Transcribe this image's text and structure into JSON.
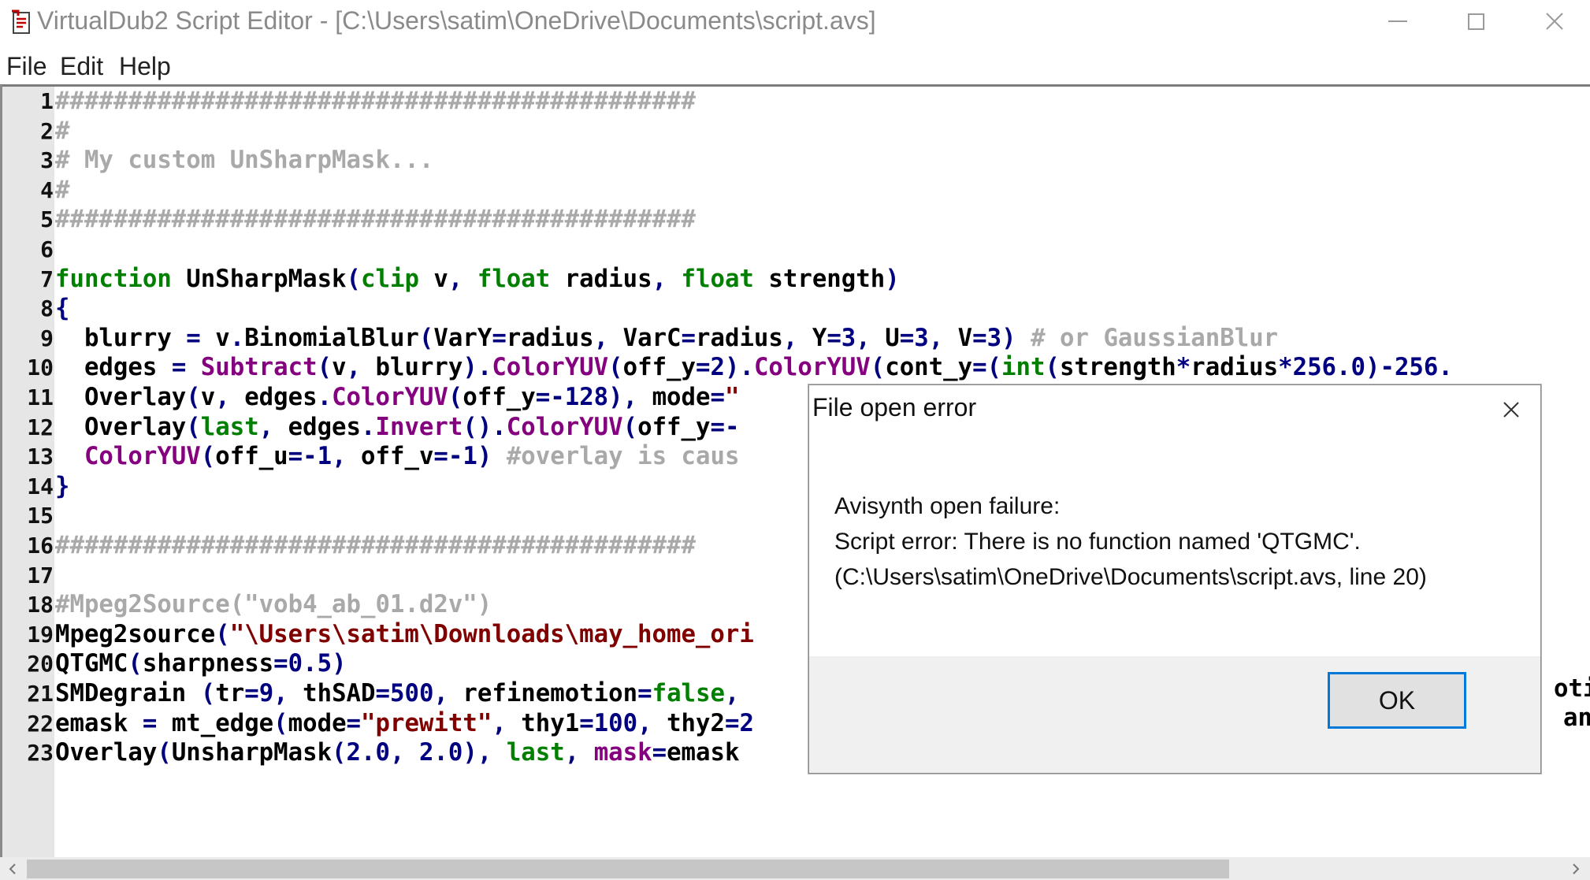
{
  "window": {
    "title": "VirtualDub2 Script Editor - [C:\\Users\\satim\\OneDrive\\Documents\\script.avs]"
  },
  "menu": {
    "file": "File",
    "edit": "Edit",
    "help": "Help"
  },
  "lines": [
    {
      "n": "1",
      "tokens": [
        [
          "cm",
          "############################################"
        ]
      ]
    },
    {
      "n": "2",
      "tokens": [
        [
          "cm",
          "#"
        ]
      ]
    },
    {
      "n": "3",
      "tokens": [
        [
          "cm",
          "# My custom UnSharpMask..."
        ]
      ]
    },
    {
      "n": "4",
      "tokens": [
        [
          "cm",
          "#"
        ]
      ]
    },
    {
      "n": "5",
      "tokens": [
        [
          "cm",
          "############################################"
        ]
      ]
    },
    {
      "n": "6",
      "tokens": []
    },
    {
      "n": "7",
      "tokens": [
        [
          "kw",
          "function"
        ],
        [
          "tx",
          " UnSharpMask"
        ],
        [
          "op",
          "("
        ],
        [
          "kw",
          "clip"
        ],
        [
          "tx",
          " v"
        ],
        [
          "op",
          ","
        ],
        [
          "tx",
          " "
        ],
        [
          "kw",
          "float"
        ],
        [
          "tx",
          " radius"
        ],
        [
          "op",
          ","
        ],
        [
          "tx",
          " "
        ],
        [
          "kw",
          "float"
        ],
        [
          "tx",
          " strength"
        ],
        [
          "op",
          ")"
        ]
      ]
    },
    {
      "n": "8",
      "tokens": [
        [
          "op",
          "{"
        ]
      ]
    },
    {
      "n": "9",
      "tokens": [
        [
          "tx",
          "  blurry "
        ],
        [
          "op",
          "="
        ],
        [
          "tx",
          " v"
        ],
        [
          "op",
          "."
        ],
        [
          "tx",
          "BinomialBlur"
        ],
        [
          "op",
          "("
        ],
        [
          "tx",
          "VarY"
        ],
        [
          "op",
          "="
        ],
        [
          "tx",
          "radius"
        ],
        [
          "op",
          ","
        ],
        [
          "tx",
          " VarC"
        ],
        [
          "op",
          "="
        ],
        [
          "tx",
          "radius"
        ],
        [
          "op",
          ","
        ],
        [
          "tx",
          " Y"
        ],
        [
          "op",
          "="
        ],
        [
          "nb",
          "3"
        ],
        [
          "op",
          ","
        ],
        [
          "tx",
          " U"
        ],
        [
          "op",
          "="
        ],
        [
          "nb",
          "3"
        ],
        [
          "op",
          ","
        ],
        [
          "tx",
          " V"
        ],
        [
          "op",
          "="
        ],
        [
          "nb",
          "3"
        ],
        [
          "op",
          ")"
        ],
        [
          "tx",
          " "
        ],
        [
          "cm",
          "# or GaussianBlur"
        ]
      ]
    },
    {
      "n": "10",
      "tokens": [
        [
          "tx",
          "  edges "
        ],
        [
          "op",
          "="
        ],
        [
          "tx",
          " "
        ],
        [
          "fn",
          "Subtract"
        ],
        [
          "op",
          "("
        ],
        [
          "tx",
          "v"
        ],
        [
          "op",
          ","
        ],
        [
          "tx",
          " blurry"
        ],
        [
          "op",
          ")."
        ],
        [
          "fn",
          "ColorYUV"
        ],
        [
          "op",
          "("
        ],
        [
          "tx",
          "off_y"
        ],
        [
          "op",
          "="
        ],
        [
          "nb",
          "2"
        ],
        [
          "op",
          ")."
        ],
        [
          "fn",
          "ColorYUV"
        ],
        [
          "op",
          "("
        ],
        [
          "tx",
          "cont_y"
        ],
        [
          "op",
          "=("
        ],
        [
          "kw",
          "int"
        ],
        [
          "op",
          "("
        ],
        [
          "tx",
          "strength"
        ],
        [
          "op",
          "*"
        ],
        [
          "tx",
          "radius"
        ],
        [
          "op",
          "*"
        ],
        [
          "nb",
          "256.0"
        ],
        [
          "op",
          ")-"
        ],
        [
          "nb",
          "256."
        ]
      ]
    },
    {
      "n": "11",
      "tokens": [
        [
          "tx",
          "  Overlay"
        ],
        [
          "op",
          "("
        ],
        [
          "tx",
          "v"
        ],
        [
          "op",
          ","
        ],
        [
          "tx",
          " edges"
        ],
        [
          "op",
          "."
        ],
        [
          "fn",
          "ColorYUV"
        ],
        [
          "op",
          "("
        ],
        [
          "tx",
          "off_y"
        ],
        [
          "op",
          "=-"
        ],
        [
          "nb",
          "128"
        ],
        [
          "op",
          "),"
        ],
        [
          "tx",
          " mode"
        ],
        [
          "op",
          "="
        ],
        [
          "st",
          "\""
        ]
      ]
    },
    {
      "n": "12",
      "tokens": [
        [
          "tx",
          "  Overlay"
        ],
        [
          "op",
          "("
        ],
        [
          "kw",
          "last"
        ],
        [
          "op",
          ","
        ],
        [
          "tx",
          " edges"
        ],
        [
          "op",
          "."
        ],
        [
          "fn",
          "Invert"
        ],
        [
          "op",
          "()."
        ],
        [
          "fn",
          "ColorYUV"
        ],
        [
          "op",
          "("
        ],
        [
          "tx",
          "off_y"
        ],
        [
          "op",
          "=-"
        ]
      ]
    },
    {
      "n": "13",
      "tokens": [
        [
          "tx",
          "  "
        ],
        [
          "fn",
          "ColorYUV"
        ],
        [
          "op",
          "("
        ],
        [
          "tx",
          "off_u"
        ],
        [
          "op",
          "=-"
        ],
        [
          "nb",
          "1"
        ],
        [
          "op",
          ","
        ],
        [
          "tx",
          " off_v"
        ],
        [
          "op",
          "=-"
        ],
        [
          "nb",
          "1"
        ],
        [
          "op",
          ")"
        ],
        [
          "tx",
          " "
        ],
        [
          "cm",
          "#overlay is caus"
        ]
      ]
    },
    {
      "n": "14",
      "tokens": [
        [
          "op",
          "}"
        ]
      ]
    },
    {
      "n": "15",
      "tokens": []
    },
    {
      "n": "16",
      "tokens": [
        [
          "cm",
          "############################################"
        ]
      ]
    },
    {
      "n": "17",
      "tokens": []
    },
    {
      "n": "18",
      "tokens": [
        [
          "cm",
          "#Mpeg2Source(\"vob4_ab_01.d2v\")"
        ]
      ]
    },
    {
      "n": "19",
      "tokens": [
        [
          "tx",
          "Mpeg2source"
        ],
        [
          "op",
          "("
        ],
        [
          "st",
          "\"\\Users\\satim\\Downloads\\may_home_ori"
        ]
      ]
    },
    {
      "n": "20",
      "tokens": [
        [
          "tx",
          "QTGMC"
        ],
        [
          "op",
          "("
        ],
        [
          "tx",
          "sharpness"
        ],
        [
          "op",
          "="
        ],
        [
          "nb",
          "0.5"
        ],
        [
          "op",
          ")"
        ]
      ]
    },
    {
      "n": "21",
      "tokens": [
        [
          "tx",
          "SMDegrain "
        ],
        [
          "op",
          "("
        ],
        [
          "tx",
          "tr"
        ],
        [
          "op",
          "="
        ],
        [
          "nb",
          "9"
        ],
        [
          "op",
          ","
        ],
        [
          "tx",
          " thSAD"
        ],
        [
          "op",
          "="
        ],
        [
          "nb",
          "500"
        ],
        [
          "op",
          ","
        ],
        [
          "tx",
          " refinemotion"
        ],
        [
          "op",
          "="
        ],
        [
          "kw",
          "false"
        ],
        [
          "op",
          ","
        ]
      ]
    },
    {
      "n": "22",
      "tokens": [
        [
          "tx",
          "emask "
        ],
        [
          "op",
          "="
        ],
        [
          "tx",
          " mt_edge"
        ],
        [
          "op",
          "("
        ],
        [
          "tx",
          "mode"
        ],
        [
          "op",
          "="
        ],
        [
          "st",
          "\"prewitt\""
        ],
        [
          "op",
          ","
        ],
        [
          "tx",
          " thy1"
        ],
        [
          "op",
          "="
        ],
        [
          "nb",
          "100"
        ],
        [
          "op",
          ","
        ],
        [
          "tx",
          " thy2"
        ],
        [
          "op",
          "="
        ],
        [
          "nb",
          "2"
        ]
      ]
    },
    {
      "n": "23",
      "tokens": [
        [
          "tx",
          "Overlay"
        ],
        [
          "op",
          "("
        ],
        [
          "tx",
          "UnsharpMask"
        ],
        [
          "op",
          "("
        ],
        [
          "nb",
          "2.0"
        ],
        [
          "op",
          ","
        ],
        [
          "tx",
          " "
        ],
        [
          "nb",
          "2.0"
        ],
        [
          "op",
          "),"
        ],
        [
          "tx",
          " "
        ],
        [
          "kw",
          "last"
        ],
        [
          "op",
          ","
        ],
        [
          "tx",
          " "
        ],
        [
          "fn",
          "mask"
        ],
        [
          "op",
          "="
        ],
        [
          "tx",
          "emask"
        ]
      ]
    }
  ],
  "overflow_text": {
    "line21": "otic",
    "line22": "and"
  },
  "dialog": {
    "title": "File open error",
    "message_line1": "Avisynth open failure:",
    "message_line2": "Script error: There is no function named 'QTGMC'.",
    "message_line3": "(C:\\Users\\satim\\OneDrive\\Documents\\script.avs, line 20)",
    "ok_label": "OK"
  },
  "colors": {
    "comment": "#a9a9a9",
    "keyword": "#007f00",
    "builtin_function": "#85007f",
    "string": "#800000",
    "number": "#000080",
    "operator": "#00007f",
    "dialog_accent": "#0078d7"
  },
  "icons": {
    "app": "script-editor-app-icon",
    "minimize": "minimize-icon",
    "maximize": "maximize-icon",
    "close": "close-icon",
    "dialog_close": "close-icon",
    "scroll_left": "chevron-left-icon",
    "scroll_right": "chevron-right-icon"
  }
}
